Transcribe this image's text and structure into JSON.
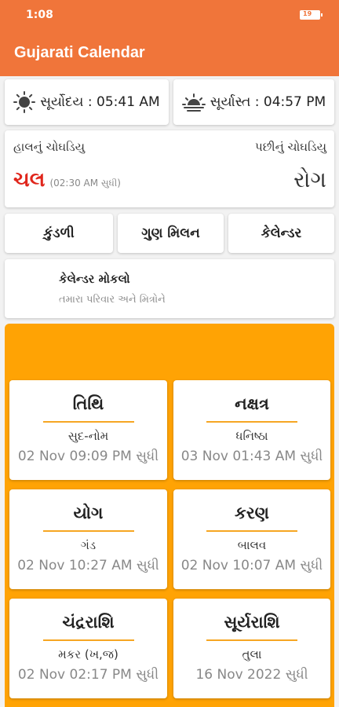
{
  "status": {
    "time": "1:08",
    "battery": "19"
  },
  "app": {
    "title": "Gujarati Calendar"
  },
  "sun": {
    "sunrise": "સૂર્યોદય : 05:41 AM",
    "sunset": "સૂર્યાસ્ત : 04:57 PM"
  },
  "choghadiya": {
    "current_label": "હાલનું ચોઘડિયુ",
    "next_label": "પછીનું ચોઘડિયુ",
    "current_value": "ચલ",
    "current_until": "(02:30 AM સુધી)",
    "next_value": "રોગ"
  },
  "actions": {
    "kundli": "કુંડળી",
    "gun_milan": "ગુણ મિલન",
    "calendar": "કેલેન્ડર"
  },
  "send": {
    "title": "કેલેન્ડર મોકલો",
    "subtitle": "તમારા પરિવાર અને મિત્રોને"
  },
  "panchang": [
    {
      "title": "તિથિ",
      "value": "સુદ-નોમ",
      "time": "02 Nov 09:09 PM સુધી"
    },
    {
      "title": "નક્ષત્ર",
      "value": "ધનિષ્ઠા",
      "time": "03 Nov 01:43 AM સુધી"
    },
    {
      "title": "યોગ",
      "value": "ગંડ",
      "time": "02 Nov 10:27 AM સુધી"
    },
    {
      "title": "કરણ",
      "value": "બાલવ",
      "time": "02 Nov 10:07 AM સુધી"
    },
    {
      "title": "ચંદ્રરાશિ",
      "value": "મકર (ખ,જ)",
      "time": "02 Nov 02:17 PM સુધી"
    },
    {
      "title": "સૂર્યરાશિ",
      "value": "તુલા",
      "time": "16 Nov 2022 સુધી"
    }
  ],
  "colors": {
    "primary": "#f0753a",
    "accent": "#ffa304",
    "current": "#e0261c",
    "divider": "#f6a623"
  },
  "icons": {
    "sunrise": "sunrise-icon",
    "sunset": "sunset-icon",
    "send": "send-calendar-icon"
  }
}
